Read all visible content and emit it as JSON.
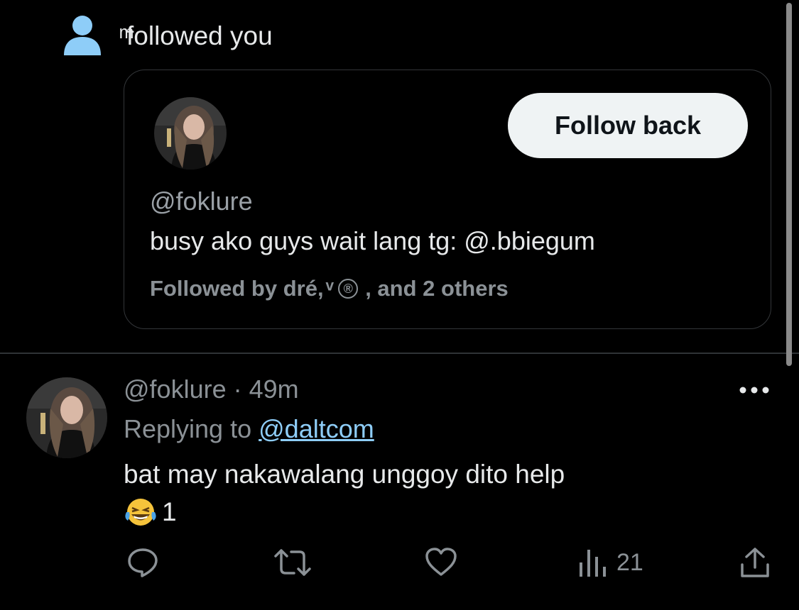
{
  "notification": {
    "icon": "person-icon",
    "text": "ͫfollowed you"
  },
  "profile_card": {
    "handle": "@foklure",
    "bio": "busy ako guys wait lang tg: @.bbiegum",
    "follow_button": "Follow back",
    "followed_by_prefix": "Followed by dré, ͮ",
    "followed_by_icon": "®",
    "followed_by_suffix": ", and 2 others"
  },
  "tweet": {
    "handle": "@foklure",
    "time": "· 49m",
    "replying_label": "Replying to",
    "replying_to": "@daltcom",
    "text": "bat may nakawalang unggoy dito help",
    "reaction_emoji": "laughing-tears-emoji",
    "reaction_count": "1",
    "views": "21"
  },
  "colors": {
    "background": "#000000",
    "accent_link": "#8ecdf8",
    "notif_icon": "#8ecdf8",
    "muted_text": "#8b9196",
    "button_bg": "#eff3f4"
  }
}
